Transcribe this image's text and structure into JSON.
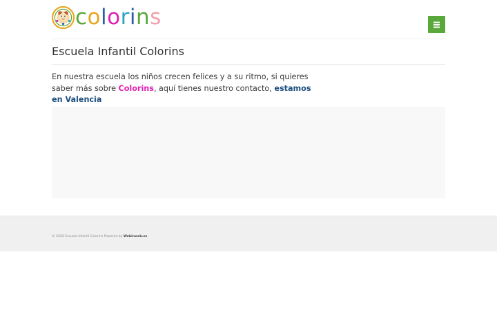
{
  "logo": {
    "emblem_icon": "kindergarten-emblem-icon",
    "letters": [
      {
        "char": "c",
        "color": "#5aa83c"
      },
      {
        "char": "o",
        "color": "#e8a51f"
      },
      {
        "char": "l",
        "color": "#2a5da8"
      },
      {
        "char": "o",
        "color": "#e020b4"
      },
      {
        "char": "r",
        "color": "#2aa2c2"
      },
      {
        "char": "i",
        "color": "#2a5da8"
      },
      {
        "char": "n",
        "color": "#5aa83c"
      },
      {
        "char": "s",
        "color": "#f0a0a8"
      }
    ]
  },
  "menu": {
    "icon": "hamburger-menu-icon",
    "color": "#5aa83c"
  },
  "page": {
    "title": "Escuela Infantil Colorins",
    "intro_before": "En nuestra escuela los niños crecen felices y a su ritmo, si quieres saber más sobre ",
    "brand_link": "Colorins",
    "intro_middle": ", aquí tienes nuestro contacto, ",
    "location_link": "estamos en Valencia",
    "brand_color": "#e020b4",
    "location_color": "#1d4e7e"
  },
  "footer": {
    "copyright": "© 2020 Escuela Infantil Colorins Powered by ",
    "powered_link": "Webinweb.es"
  }
}
